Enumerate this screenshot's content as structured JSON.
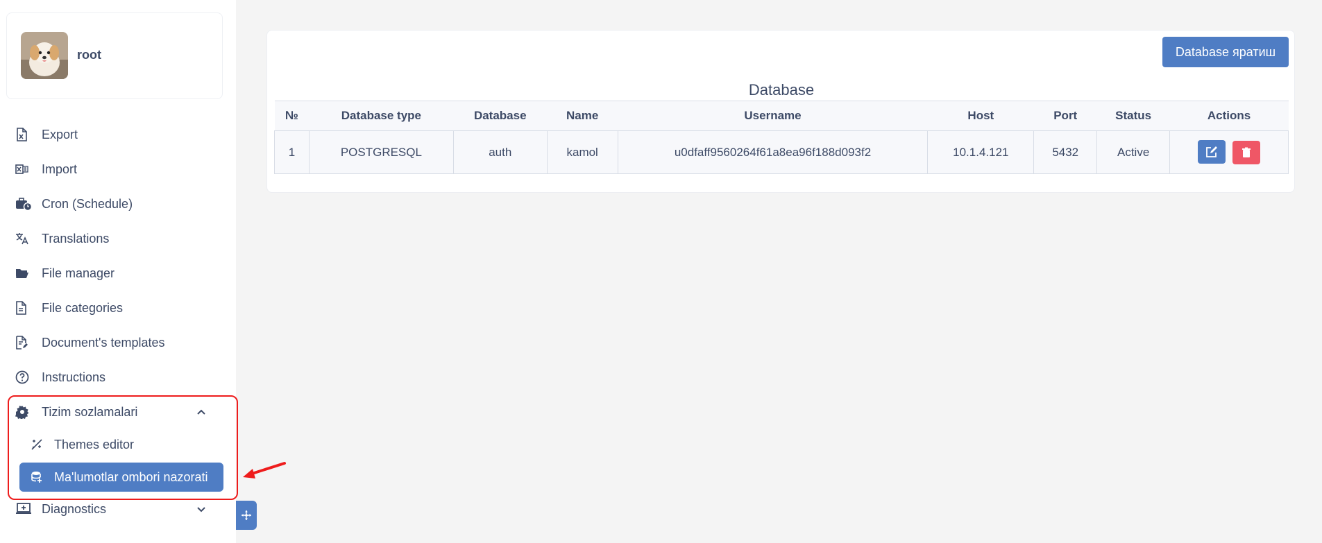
{
  "profile": {
    "name": "root"
  },
  "sidebar": {
    "items": [
      {
        "label": "Export",
        "icon": "excel-export-icon"
      },
      {
        "label": "Import",
        "icon": "excel-import-icon"
      },
      {
        "label": "Cron (Schedule)",
        "icon": "briefcase-clock-icon"
      },
      {
        "label": "Translations",
        "icon": "translate-icon"
      },
      {
        "label": "File manager",
        "icon": "folder-open-icon"
      },
      {
        "label": "File categories",
        "icon": "file-icon"
      },
      {
        "label": "Document's templates",
        "icon": "file-edit-icon"
      },
      {
        "label": "Instructions",
        "icon": "question-circle-icon"
      },
      {
        "label": "Tizim sozlamalari",
        "icon": "gear-icon",
        "expanded": true
      },
      {
        "label": "Diagnostics",
        "icon": "laptop-plus-icon",
        "expanded": false
      }
    ],
    "submenu": [
      {
        "label": "Themes editor",
        "icon": "palette-icon"
      },
      {
        "label": "Ma'lumotlar ombori nazorati",
        "icon": "database-icon",
        "active": true
      }
    ]
  },
  "main": {
    "create_button": "Database яратиш",
    "table_title": "Database",
    "columns": [
      "№",
      "Database type",
      "Database",
      "Name",
      "Username",
      "Host",
      "Port",
      "Status",
      "Actions"
    ],
    "rows": [
      [
        "1",
        "POSTGRESQL",
        "auth",
        "kamol",
        "u0dfaff9560264f61a8ea96f188d093f2",
        "10.1.4.121",
        "5432",
        "Active"
      ]
    ]
  },
  "colors": {
    "primary": "#4f7dc4",
    "danger": "#ef5766",
    "annotation": "#ee1c1c",
    "text": "#3d4a66"
  }
}
